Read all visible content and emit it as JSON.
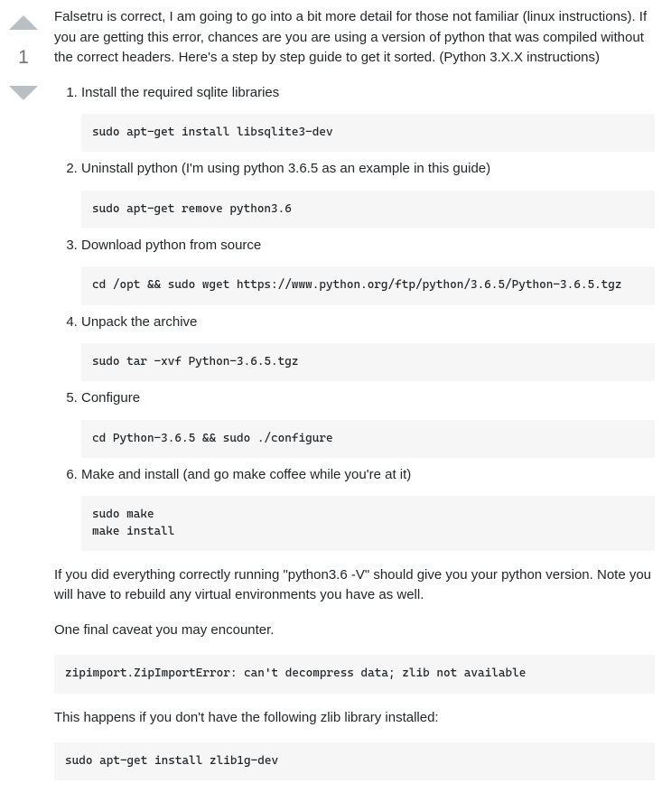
{
  "vote": {
    "count": "1"
  },
  "intro": "Falsetru is correct, I am going to go into a bit more detail for those not familiar (linux instructions). If you are getting this error, chances are you are using a version of python that was compiled without the correct headers. Here's a step by step guide to get it sorted. (Python 3.X.X instructions)",
  "steps": [
    {
      "text": "Install the required sqlite libraries",
      "code": "sudo apt-get install libsqlite3-dev"
    },
    {
      "text": "Uninstall python (I'm using python 3.6.5 as an example in this guide)",
      "code": "sudo apt-get remove python3.6"
    },
    {
      "text": "Download python from source",
      "code": "cd /opt && sudo wget https://www.python.org/ftp/python/3.6.5/Python-3.6.5.tgz"
    },
    {
      "text": "Unpack the archive",
      "code": "sudo tar -xvf Python-3.6.5.tgz"
    },
    {
      "text": "Configure",
      "code": "cd Python-3.6.5 && sudo ./configure"
    },
    {
      "text": "Make and install (and go make coffee while you're at it)",
      "code": "sudo make\nmake install"
    }
  ],
  "closing1": "If you did everything correctly running \"python3.6 -V\" should give you your python version. Note you will have to rebuild any virtual environments you have as well.",
  "closing2": "One final caveat you may encounter.",
  "error_code": "zipimport.ZipImportError: can't decompress data; zlib not available",
  "error_explain": "This happens if you don't have the following zlib library installed:",
  "fix_code": "sudo apt-get install zlib1g-dev"
}
